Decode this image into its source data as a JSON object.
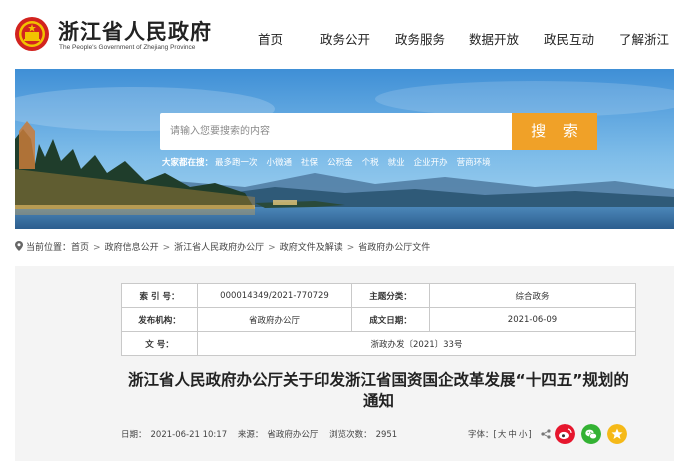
{
  "header": {
    "title": "浙江省人民政府",
    "subtitle": "The People's Government of Zhejiang Province",
    "nav": [
      {
        "label": "首页"
      },
      {
        "label": "政务公开"
      },
      {
        "label": "政务服务"
      },
      {
        "label": "数据开放"
      },
      {
        "label": "政民互动"
      },
      {
        "label": "了解浙江"
      }
    ]
  },
  "search": {
    "placeholder": "请输入您要搜索的内容",
    "button_label": "搜 索",
    "hot_label": "大家都在搜：",
    "hot_words": [
      "最多跑一次",
      "小微通",
      "社保",
      "公积金",
      "个税",
      "就业",
      "企业开办",
      "营商环境"
    ]
  },
  "breadcrumb": {
    "prefix": "当前位置：",
    "items": [
      "首页",
      "政府信息公开",
      "浙江省人民政府办公厅",
      "政府文件及解读",
      "省政府办公厅文件"
    ]
  },
  "meta": {
    "index_label": "索 引 号：",
    "index_value": "000014349/2021-770729",
    "category_label": "主题分类：",
    "category_value": "综合政务",
    "issuer_label": "发布机构：",
    "issuer_value": "省政府办公厅",
    "date_label": "成文日期：",
    "date_value": "2021-06-09",
    "docno_label": "文 号：",
    "docno_value": "浙政办发〔2021〕33号"
  },
  "doc": {
    "title": "浙江省人民政府办公厅关于印发浙江省国资国企改革发展“十四五”规划的通知",
    "date_label": "日期：",
    "date_value": "2021-06-21 10:17",
    "source_label": "来源：",
    "source_value": "省政府办公厅",
    "views_label": "浏览次数：",
    "views_value": "2951",
    "font_label": "字体：[",
    "font_options": [
      "大",
      "中",
      "小"
    ],
    "font_close": "]"
  },
  "colors": {
    "accent": "#f0a128",
    "emblem_red": "#d2231f",
    "weibo": "#e6162d",
    "wechat": "#33b233",
    "favorite": "#f5b918"
  },
  "icons": [
    "emblem-icon",
    "location-pin-icon",
    "share-icon",
    "weibo-icon",
    "wechat-icon",
    "star-icon"
  ]
}
